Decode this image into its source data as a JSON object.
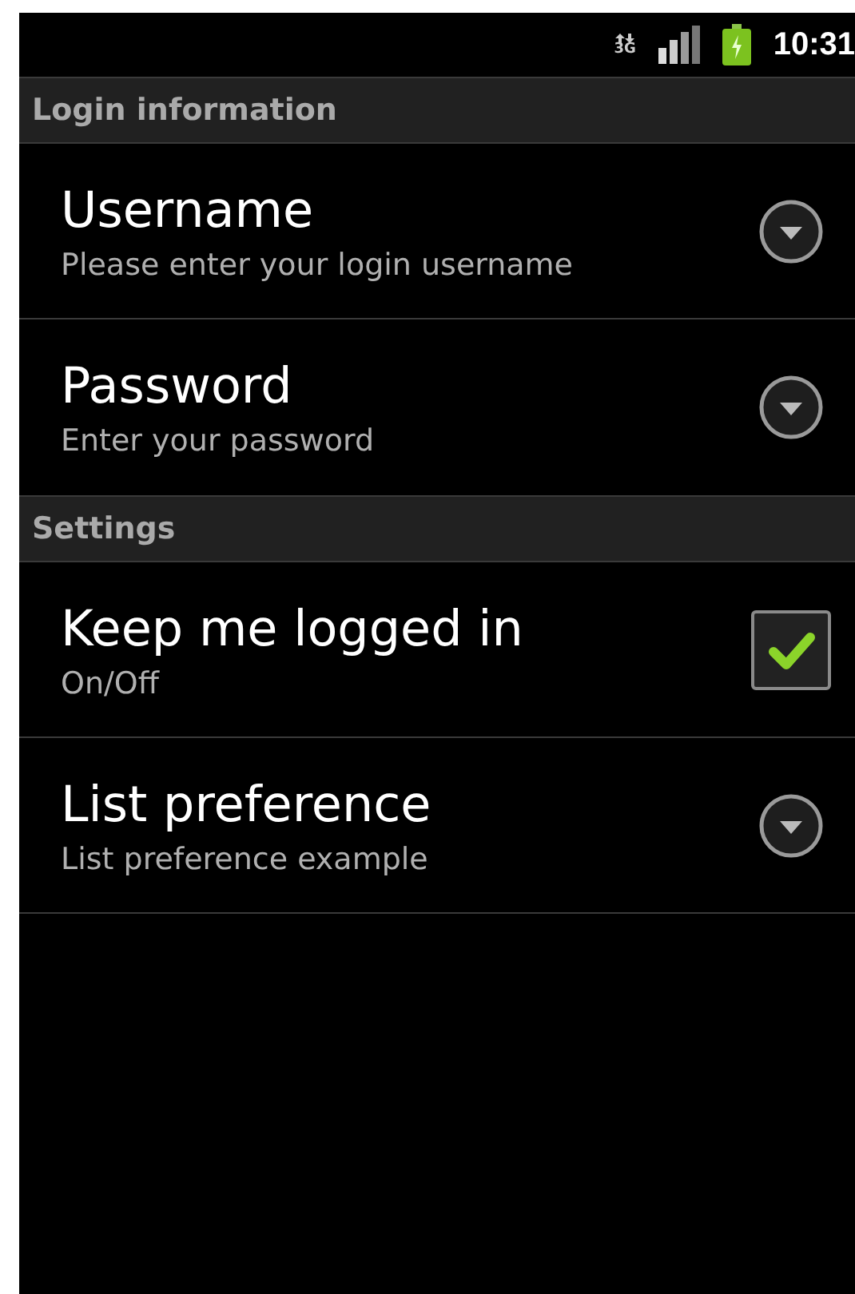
{
  "status_bar": {
    "network": "3G",
    "time": "10:31"
  },
  "sections": [
    {
      "title": "Login information",
      "items": [
        {
          "kind": "dialog",
          "title": "Username",
          "summary": "Please enter your login username"
        },
        {
          "kind": "dialog",
          "title": "Password",
          "summary": "Enter your password"
        }
      ]
    },
    {
      "title": "Settings",
      "items": [
        {
          "kind": "checkbox",
          "title": "Keep me logged in",
          "summary": "On/Off",
          "checked": true
        },
        {
          "kind": "dialog",
          "title": "List preference",
          "summary": "List preference example"
        }
      ]
    }
  ]
}
